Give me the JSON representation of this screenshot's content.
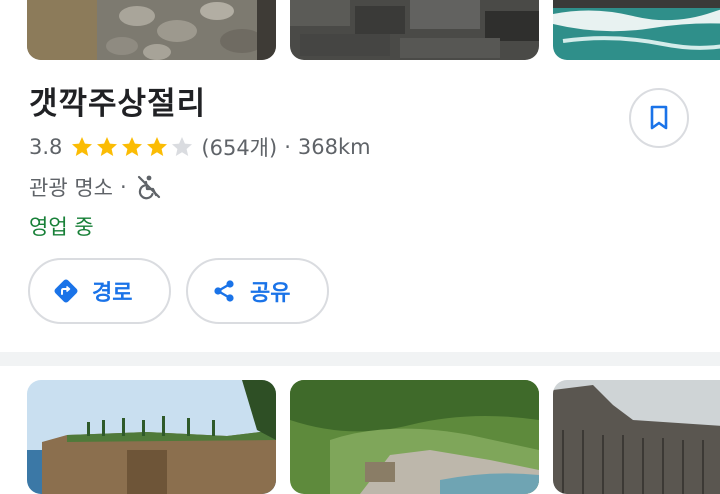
{
  "place": {
    "name": "갯깍주상절리",
    "rating": "3.8",
    "review_count": "(654개)",
    "distance_sep": "·",
    "distance": "368km",
    "category": "관광 명소",
    "category_sep": "·",
    "open_status": "영업 중",
    "stars_filled": 4,
    "stars_total": 5
  },
  "actions": {
    "route_label": "경로",
    "share_label": "공유"
  },
  "icons": {
    "save": "bookmark-icon",
    "route": "directions-icon",
    "share": "share-icon",
    "accessibility": "no-wheelchair-icon"
  },
  "colors": {
    "star_filled": "#fbbc04",
    "star_empty": "#dadce0",
    "accent": "#1a73e8",
    "open": "#188038",
    "secondary_text": "#5f6368"
  }
}
